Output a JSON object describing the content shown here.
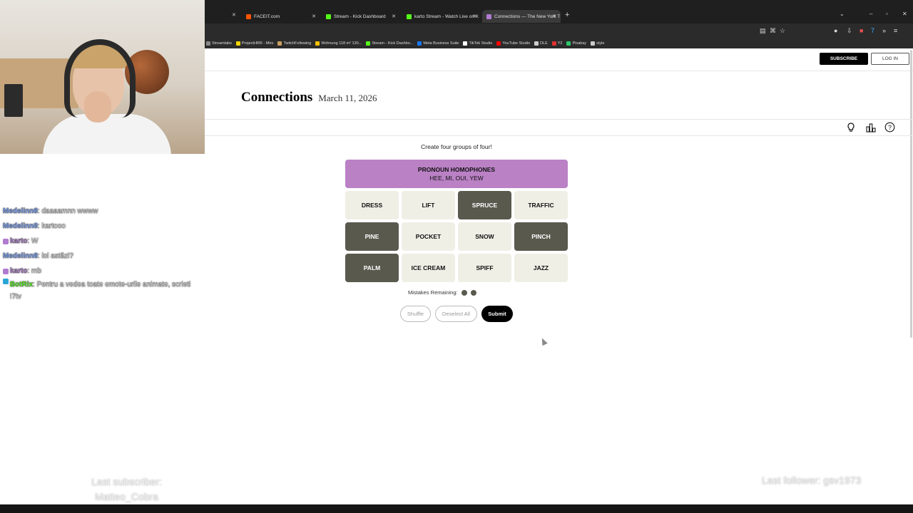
{
  "browser": {
    "tabs": [
      {
        "label": "FACEIT.com",
        "color": "#ff5500"
      },
      {
        "label": "Stream - Kick Dashboard",
        "color": "#53fc18"
      },
      {
        "label": "karto Stream - Watch Live on K",
        "color": "#53fc18"
      },
      {
        "label": "Connections — The New York T",
        "color": "#b07bd0"
      }
    ],
    "new_tab": "+",
    "bookmarks": [
      {
        "label": "Streamlabs",
        "color": "#888888"
      },
      {
        "label": "ProjectHRR - Miro",
        "color": "#f5d400"
      },
      {
        "label": "TwitchFollowing",
        "color": "#c8a060"
      },
      {
        "label": "Wohnung 118 m² 130...",
        "color": "#f0c000"
      },
      {
        "label": "Stream - Kick Dashbo...",
        "color": "#53fc18"
      },
      {
        "label": "Meta Business Suite",
        "color": "#1877f2"
      },
      {
        "label": "TikTok Studio",
        "color": "#ffffff"
      },
      {
        "label": "YouTube Studio",
        "color": "#ff0000"
      },
      {
        "label": "DLE",
        "color": "#cccccc"
      },
      {
        "label": "Y2",
        "color": "#e03030"
      },
      {
        "label": "Pixabay",
        "color": "#2ec66b"
      },
      {
        "label": "style",
        "color": "#cccccc"
      }
    ]
  },
  "chat": [
    {
      "user": "Medelinn8",
      "message": ": daaaamnn wwww",
      "color": "#7ba4ff",
      "badge": ""
    },
    {
      "user": "Medelinn8",
      "message": ": kartooo",
      "color": "#7ba4ff",
      "badge": ""
    },
    {
      "user": "karto",
      "message": ": W",
      "color": "#b07bd0",
      "badge": "#b07bd0"
    },
    {
      "user": "Medelinn8",
      "message": ": lol astăzi?",
      "color": "#7ba4ff",
      "badge": ""
    },
    {
      "user": "karto",
      "message": ": mb",
      "color": "#b07bd0",
      "badge": "#b07bd0"
    },
    {
      "user": "BotRix",
      "message": ": Pentru a vedea toate emote-urile animate, scrieti !7tv",
      "color": "#53fc18",
      "badge": "#2aa6d6"
    }
  ],
  "overlay": {
    "last_subscriber_label": "Last subscriber:",
    "last_subscriber_name": "Matteo_Cobra",
    "last_follower": "Last follower: gsv1973"
  },
  "nyt": {
    "subscribe": "SUBSCRIBE",
    "login": "LOG IN",
    "title": "Connections",
    "date": "March 11, 2026"
  },
  "game": {
    "prompt": "Create four groups of four!",
    "solved": {
      "category": "PRONOUN HOMOPHONES",
      "words": "HEE, MI, OUI, YEW",
      "color": "#ba81c5"
    },
    "tiles": [
      {
        "word": "DRESS",
        "selected": false
      },
      {
        "word": "LIFT",
        "selected": false
      },
      {
        "word": "SPRUCE",
        "selected": true
      },
      {
        "word": "TRAFFIC",
        "selected": false
      },
      {
        "word": "PINE",
        "selected": true
      },
      {
        "word": "POCKET",
        "selected": false
      },
      {
        "word": "SNOW",
        "selected": false
      },
      {
        "word": "PINCH",
        "selected": true
      },
      {
        "word": "PALM",
        "selected": true
      },
      {
        "word": "ICE CREAM",
        "selected": false
      },
      {
        "word": "SPIFF",
        "selected": false
      },
      {
        "word": "JAZZ",
        "selected": false
      }
    ],
    "mistakes_label": "Mistakes Remaining:",
    "mistakes_remaining": 2,
    "buttons": {
      "shuffle": "Shuffle",
      "deselect": "Deselect All",
      "submit": "Submit"
    }
  }
}
